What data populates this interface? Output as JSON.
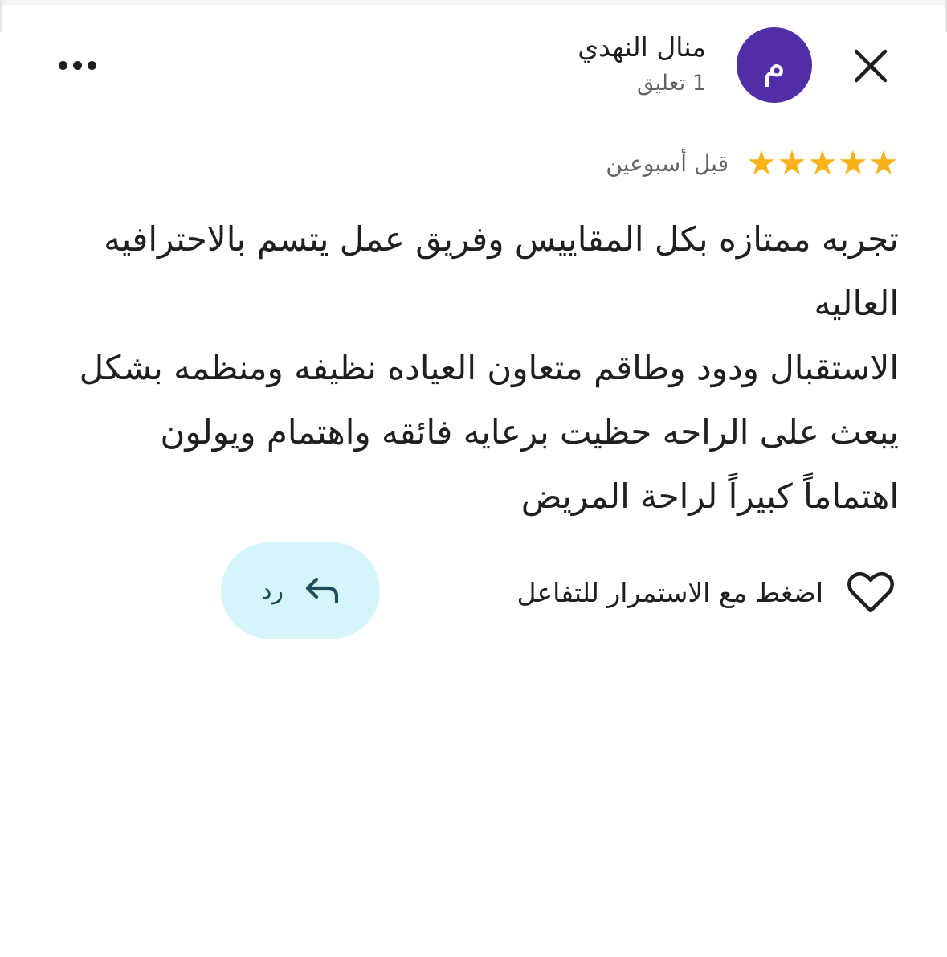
{
  "header": {
    "close_icon": "close-icon",
    "avatar_letter": "م",
    "avatar_color": "#512da8",
    "author_name": "منال النهدي",
    "author_meta": "1 تعليق",
    "more_icon": "more-horizontal-icon"
  },
  "rating": {
    "stars": 5,
    "max_stars": 5,
    "star_color": "#f8b31a",
    "time_ago": "قبل أسبوعين"
  },
  "review": {
    "paragraphs": [
      "تجربه ممتازه بكل المقاييس وفريق عمل يتسم بالاحترافيه العاليه",
      "الاستقبال ودود وطاقم متعاون العياده نظيفه ومنظمه بشكل يبعث على الراحه حظيت برعايه فائقه واهتمام ويولون اهتماماً كبيراً لراحة المريض"
    ]
  },
  "actions": {
    "like_icon": "heart-outline-icon",
    "like_label": "اضغط مع الاستمرار للتفاعل",
    "reply_icon": "reply-arrow-icon",
    "reply_label": "رد",
    "reply_bg": "#d6f5fb"
  }
}
